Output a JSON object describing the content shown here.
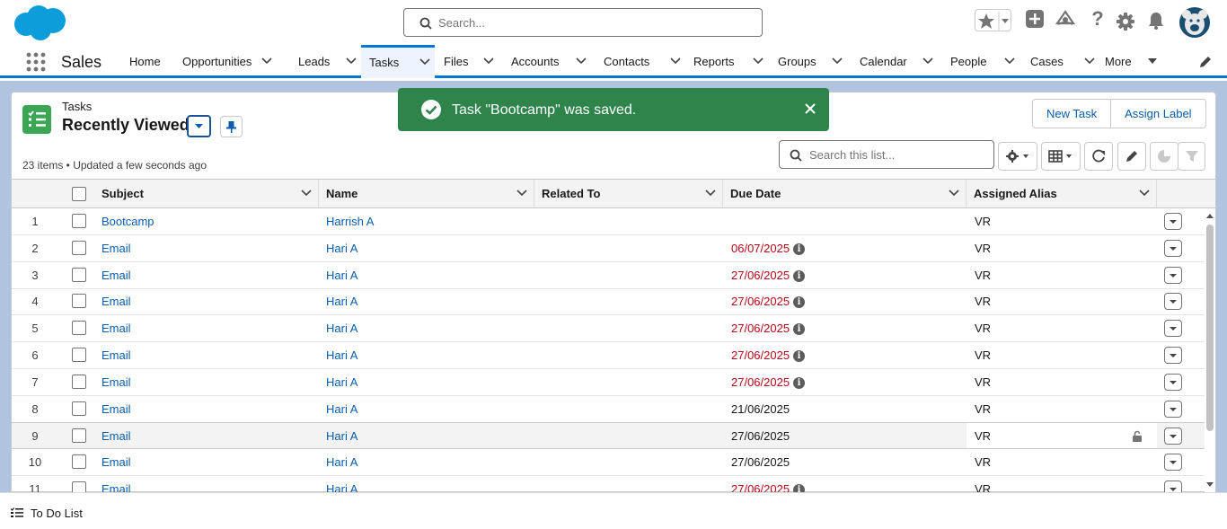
{
  "header": {
    "search_placeholder": "Search...",
    "app_name": "Sales"
  },
  "nav": {
    "items": [
      {
        "label": "Home",
        "chevron": false
      },
      {
        "label": "Opportunities",
        "chevron": true
      },
      {
        "label": "Leads",
        "chevron": true
      },
      {
        "label": "Tasks",
        "chevron": true,
        "active": true
      },
      {
        "label": "Files",
        "chevron": true
      },
      {
        "label": "Accounts",
        "chevron": true
      },
      {
        "label": "Contacts",
        "chevron": true
      },
      {
        "label": "Reports",
        "chevron": true
      },
      {
        "label": "Groups",
        "chevron": true
      },
      {
        "label": "Calendar",
        "chevron": true
      },
      {
        "label": "People",
        "chevron": true
      },
      {
        "label": "Cases",
        "chevron": true
      },
      {
        "label": "More",
        "chevron": true
      }
    ]
  },
  "list": {
    "object_label": "Tasks",
    "view_name": "Recently Viewed",
    "meta": "23 items • Updated a few seconds ago",
    "search_placeholder": "Search this list...",
    "buttons": {
      "new_task": "New Task",
      "assign_label": "Assign Label"
    },
    "columns": [
      "Subject",
      "Name",
      "Related To",
      "Due Date",
      "Assigned Alias"
    ],
    "rows": [
      {
        "n": "1",
        "subject": "Bootcamp",
        "name": "Harrish A",
        "related": "",
        "due": "",
        "overdue": false,
        "alias": "VR"
      },
      {
        "n": "2",
        "subject": "Email",
        "name": "Hari A",
        "related": "",
        "due": "06/07/2025",
        "overdue": true,
        "alias": "VR"
      },
      {
        "n": "3",
        "subject": "Email",
        "name": "Hari A",
        "related": "",
        "due": "27/06/2025",
        "overdue": true,
        "alias": "VR"
      },
      {
        "n": "4",
        "subject": "Email",
        "name": "Hari A",
        "related": "",
        "due": "27/06/2025",
        "overdue": true,
        "alias": "VR"
      },
      {
        "n": "5",
        "subject": "Email",
        "name": "Hari A",
        "related": "",
        "due": "27/06/2025",
        "overdue": true,
        "alias": "VR"
      },
      {
        "n": "6",
        "subject": "Email",
        "name": "Hari A",
        "related": "",
        "due": "27/06/2025",
        "overdue": true,
        "alias": "VR"
      },
      {
        "n": "7",
        "subject": "Email",
        "name": "Hari A",
        "related": "",
        "due": "27/06/2025",
        "overdue": true,
        "alias": "VR"
      },
      {
        "n": "8",
        "subject": "Email",
        "name": "Hari A",
        "related": "",
        "due": "21/06/2025",
        "overdue": false,
        "alias": "VR"
      },
      {
        "n": "9",
        "subject": "Email",
        "name": "Hari A",
        "related": "",
        "due": "27/06/2025",
        "overdue": false,
        "alias": "VR",
        "highlighted": true
      },
      {
        "n": "10",
        "subject": "Email",
        "name": "Hari A",
        "related": "",
        "due": "27/06/2025",
        "overdue": false,
        "alias": "VR"
      },
      {
        "n": "11",
        "subject": "Email",
        "name": "Hari A",
        "related": "",
        "due": "27/06/2025",
        "overdue": true,
        "alias": "VR"
      }
    ]
  },
  "toast": {
    "message": "Task \"Bootcamp\" was saved.",
    "color": "#2e844a"
  },
  "footer": {
    "label": "To Do List"
  },
  "colors": {
    "brand": "#0176d3",
    "link": "#0b5cab",
    "overdue": "#ba0517",
    "object_icon": "#3ba755"
  }
}
